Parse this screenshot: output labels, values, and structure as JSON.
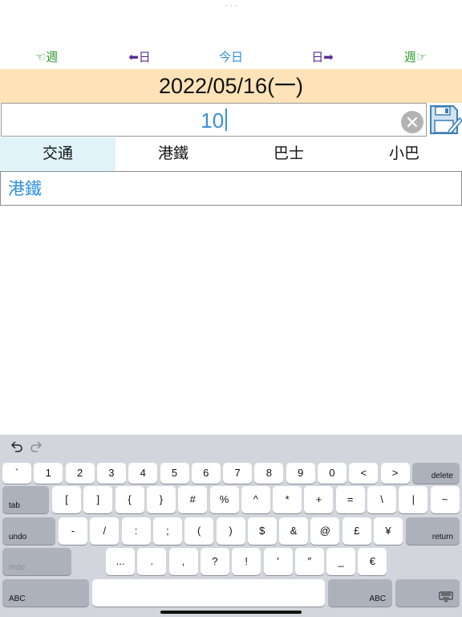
{
  "nav": {
    "prev_week": "☜週",
    "prev_day": "⬅日",
    "today": "今日",
    "next_day": "日➡",
    "next_week": "週☞"
  },
  "date_display": "2022/05/16(一)",
  "input": {
    "value": "10"
  },
  "tabs": [
    {
      "label": "交通",
      "active": true
    },
    {
      "label": "港鐵",
      "active": false
    },
    {
      "label": "巴士",
      "active": false
    },
    {
      "label": "小巴",
      "active": false
    }
  ],
  "result": {
    "text": "港鐵"
  },
  "keyboard": {
    "row1": [
      "`",
      "1",
      "2",
      "3",
      "4",
      "5",
      "6",
      "7",
      "8",
      "9",
      "0",
      "<",
      ">"
    ],
    "row1_fn": "delete",
    "row2_fn": "tab",
    "row2": [
      "[",
      "]",
      "{",
      "}",
      "#",
      "%",
      "^",
      "*",
      "+",
      "=",
      "\\",
      "|",
      "~"
    ],
    "row3_fn": "undo",
    "row3": [
      "-",
      "/",
      ":",
      ";",
      "(",
      ")",
      "$",
      "&",
      "@",
      "£",
      "¥"
    ],
    "row3_fn_right": "return",
    "row4_fn": "redo",
    "row4": [
      "...",
      ".",
      ",",
      "?",
      "!",
      "'",
      "″",
      "_",
      "€"
    ],
    "row5_left": "ABC",
    "row5_right": "ABC"
  },
  "colors": {
    "date_bar": "#fde3b7",
    "active_tab": "#dff3f8",
    "accent_blue": "#2a8fdc",
    "nav_green": "#2e9a2e",
    "nav_purple": "#5a2a96"
  }
}
